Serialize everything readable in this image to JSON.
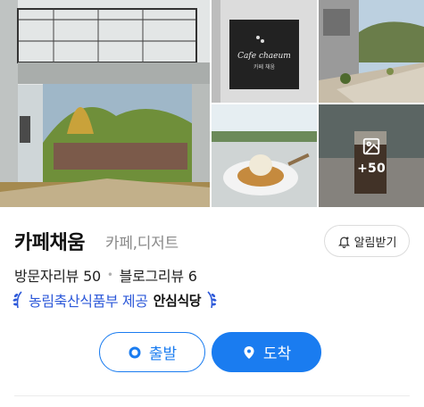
{
  "gallery": {
    "photos": [
      {
        "icon": "building-courtyard-photo"
      },
      {
        "icon": "cafe-sign-photo",
        "sign_text": "Cafe chaeum",
        "sign_subtext": "카페 채움"
      },
      {
        "icon": "countryside-road-photo"
      },
      {
        "icon": "dessert-plate-photo"
      },
      {
        "icon": "coffee-glass-photo"
      }
    ],
    "more_count": "+50"
  },
  "place": {
    "name": "카페채움",
    "category": "카페,디저트",
    "alarm_label": "알림받기"
  },
  "reviews": {
    "visitor_label": "방문자리뷰",
    "visitor_count": "50",
    "blog_label": "블로그리뷰",
    "blog_count": "6"
  },
  "badge": {
    "text": "농림축산식품부 제공",
    "brand": "안심식당"
  },
  "actions": {
    "start_label": "출발",
    "arrive_label": "도착"
  },
  "colors": {
    "accent": "#1a7cf0",
    "badge_text": "#2d59d9",
    "category_gray": "#8a8a8a"
  }
}
